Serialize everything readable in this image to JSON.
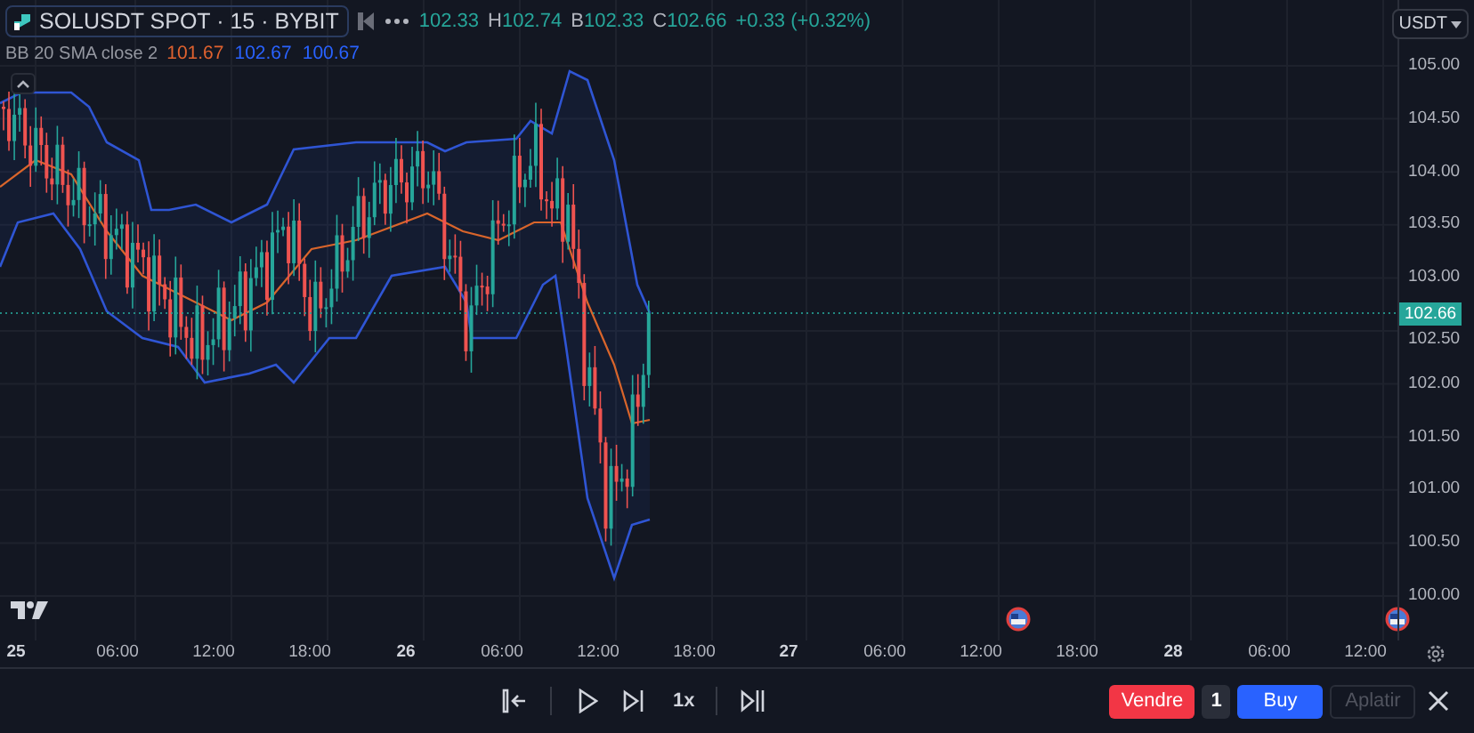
{
  "symbol": {
    "title": "SOLUSDT SPOT · 15 · BYBIT"
  },
  "ohlc": [
    {
      "value": "102.33"
    },
    {
      "label": "H",
      "value": "102.74"
    },
    {
      "label": "B",
      "value": "102.33"
    },
    {
      "label": "C",
      "value": "102.66"
    }
  ],
  "change": "+0.33 (+0.32%)",
  "indicator": {
    "name": "BB 20 SMA close 2",
    "values": [
      {
        "text": "101.67",
        "color": "#e0622f"
      },
      {
        "text": "102.67",
        "color": "#2962ff"
      },
      {
        "text": "100.67",
        "color": "#2962ff"
      }
    ]
  },
  "currency": "USDT",
  "price_axis": [
    "105.00",
    "104.50",
    "104.00",
    "103.50",
    "103.00",
    "102.50",
    "102.00",
    "101.50",
    "101.00",
    "100.50",
    "100.00"
  ],
  "last_price": "102.66",
  "time_axis": [
    {
      "text": "25",
      "kind": "day"
    },
    {
      "text": "06:00",
      "kind": "time"
    },
    {
      "text": "12:00",
      "kind": "time"
    },
    {
      "text": "18:00",
      "kind": "time"
    },
    {
      "text": "26",
      "kind": "day"
    },
    {
      "text": "06:00",
      "kind": "time"
    },
    {
      "text": "12:00",
      "kind": "time"
    },
    {
      "text": "18:00",
      "kind": "time"
    },
    {
      "text": "27",
      "kind": "day"
    },
    {
      "text": "06:00",
      "kind": "time"
    },
    {
      "text": "12:00",
      "kind": "time"
    },
    {
      "text": "18:00",
      "kind": "time"
    },
    {
      "text": "28",
      "kind": "day"
    },
    {
      "text": "06:00",
      "kind": "time"
    },
    {
      "text": "12:00",
      "kind": "time"
    }
  ],
  "replay": {
    "speed": "1x"
  },
  "trade": {
    "sell": "Vendre",
    "quantity": "1",
    "buy": "Buy",
    "flatten": {
      "label": "Aplatir",
      "disabled": true
    }
  }
}
